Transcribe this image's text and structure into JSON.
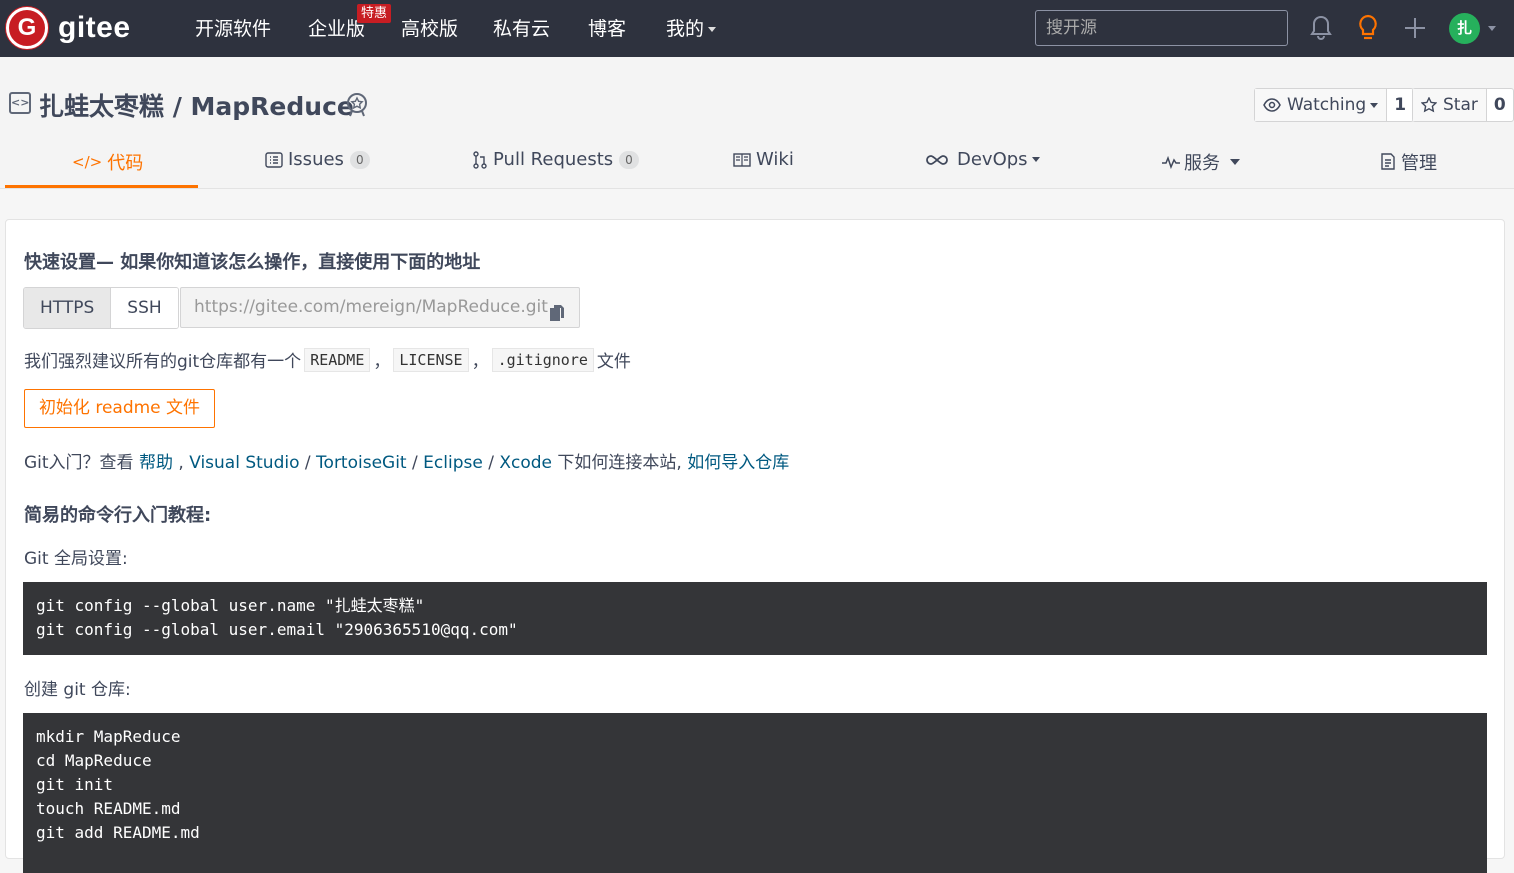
{
  "topnav": {
    "logo_letter": "G",
    "logo_text": "gitee",
    "items": [
      "开源软件",
      "企业版",
      "高校版",
      "私有云",
      "博客",
      "我的"
    ],
    "hot_badge": "特惠",
    "search_placeholder": "搜开源",
    "avatar_initial": "扎"
  },
  "repo": {
    "title": "扎蛙太枣糕 / MapReduce",
    "watching_label": "Watching",
    "watching_count": "1",
    "star_label": "Star",
    "star_count": "0"
  },
  "tabs": [
    {
      "label": "代码",
      "count": ""
    },
    {
      "label": "Issues",
      "count": "0"
    },
    {
      "label": "Pull Requests",
      "count": "0"
    },
    {
      "label": "Wiki",
      "count": ""
    },
    {
      "label": "DevOps",
      "count": ""
    },
    {
      "label": "服务",
      "count": ""
    },
    {
      "label": "管理",
      "count": ""
    }
  ],
  "quick": {
    "title": "快速设置— 如果你知道该怎么操作，直接使用下面的地址",
    "https_label": "HTTPS",
    "ssh_label": "SSH",
    "url": "https://gitee.com/mereign/MapReduce.git",
    "recommend_prefix": "我们强烈建议所有的git仓库都有一个",
    "file1": "README",
    "file2": "LICENSE",
    "file3": ".gitignore",
    "recommend_suffix": "文件",
    "sep": "，",
    "init_button": "初始化 readme 文件",
    "intro_prefix": "Git入门？查看 ",
    "link_help": "帮助",
    "link_vs": "Visual Studio",
    "link_tortoise": "TortoiseGit",
    "link_eclipse": "Eclipse",
    "link_xcode": "Xcode",
    "intro_mid": " 下如何连接本站, ",
    "link_import": "如何导入仓库",
    "slash": " / ",
    "comma": " , "
  },
  "tutorial": {
    "title": "简易的命令行入门教程:",
    "global_label": "Git 全局设置:",
    "global_code": "git config --global user.name \"扎蛙太枣糕\"\ngit config --global user.email \"2906365510@qq.com\"",
    "create_label": "创建 git 仓库:",
    "create_code": "mkdir MapReduce\ncd MapReduce\ngit init\ntouch README.md\ngit add README.md"
  }
}
